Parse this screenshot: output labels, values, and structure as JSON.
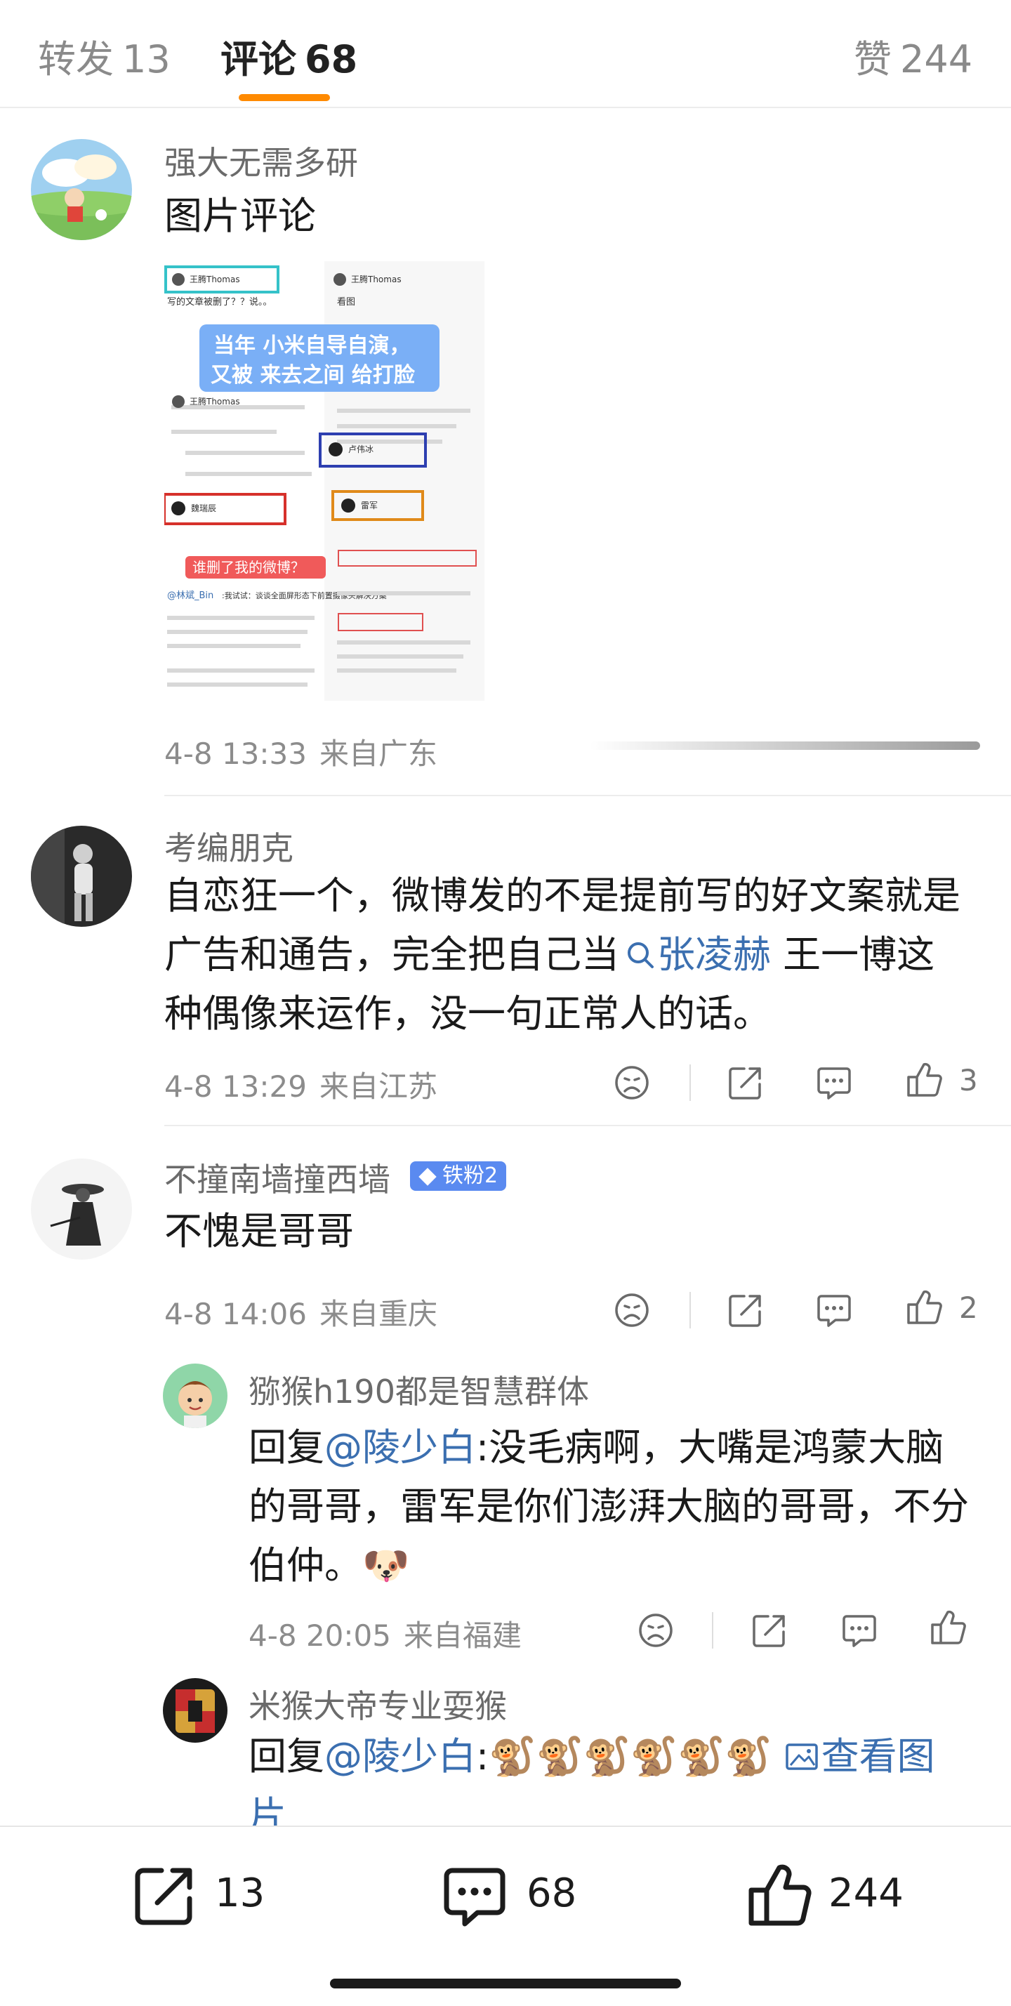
{
  "tabs": [
    {
      "label": "转发",
      "count": "13"
    },
    {
      "label": "评论",
      "count": "68"
    },
    {
      "label": "赞",
      "count": "244"
    }
  ],
  "comments": [
    {
      "user": "强大无需多研",
      "text": "图片评论",
      "time": "4-8 13:33",
      "location": "来自广东",
      "image": {
        "overlay_top": "当年 小米自导自演，",
        "overlay_bottom": "又被 来去之间 给打脸",
        "overlay_red": "谁删了我的微博？",
        "names": [
          "王腾Thomas",
          "王腾Thomas",
          "卢伟冰",
          "雷军",
          "魏瑞辰"
        ],
        "post_first": "写的文章被删了？？说。。",
        "post_second": "看图",
        "mention": "@林斌_Bin",
        "mention_text": ":我试试：谈谈全面屏形态下前置摄像头解决方案"
      }
    },
    {
      "user": "考编朋克",
      "text_lines": [
        "自恋狂一个，微博发的不是提前写的好文案就是",
        "广告和通告，完全把自己当",
        "种偶像来运作，没一句正常人的话。"
      ],
      "link": "张凌赫",
      "after_link": " 王一博这",
      "time": "4-8 13:29",
      "location": "来自江苏",
      "likes": "3"
    },
    {
      "user": "不撞南墙撞西墙",
      "badge": "铁粉2",
      "text": "不愧是哥哥",
      "time": "4-8 14:06",
      "location": "来自重庆",
      "likes": "2"
    }
  ],
  "replies": [
    {
      "user": "猕猴h190都是智慧群体",
      "prefix": "回复",
      "mention": "@陵少白",
      "line1": ":没毛病啊，大嘴是鸿蒙大脑",
      "line2": "的哥哥，雷军是你们澎湃大脑的哥哥，不分",
      "line3": "伯仲。",
      "emoji": "🐶",
      "time": "4-8 20:05",
      "location": "来自福建"
    },
    {
      "user": "米猴大帝专业耍猴",
      "prefix": "回复",
      "mention": "@陵少白",
      "colon": ":",
      "emojis": "🐒🐒🐒🐒🐒🐒",
      "view_image": "查看图",
      "view_image_wrap": "片"
    }
  ],
  "bottom_bar": {
    "share_count": "13",
    "comment_count": "68",
    "like_count": "244"
  },
  "colors": {
    "accent": "#ff8a00",
    "link": "#3b6fb0",
    "badge": "#5a8af0"
  }
}
